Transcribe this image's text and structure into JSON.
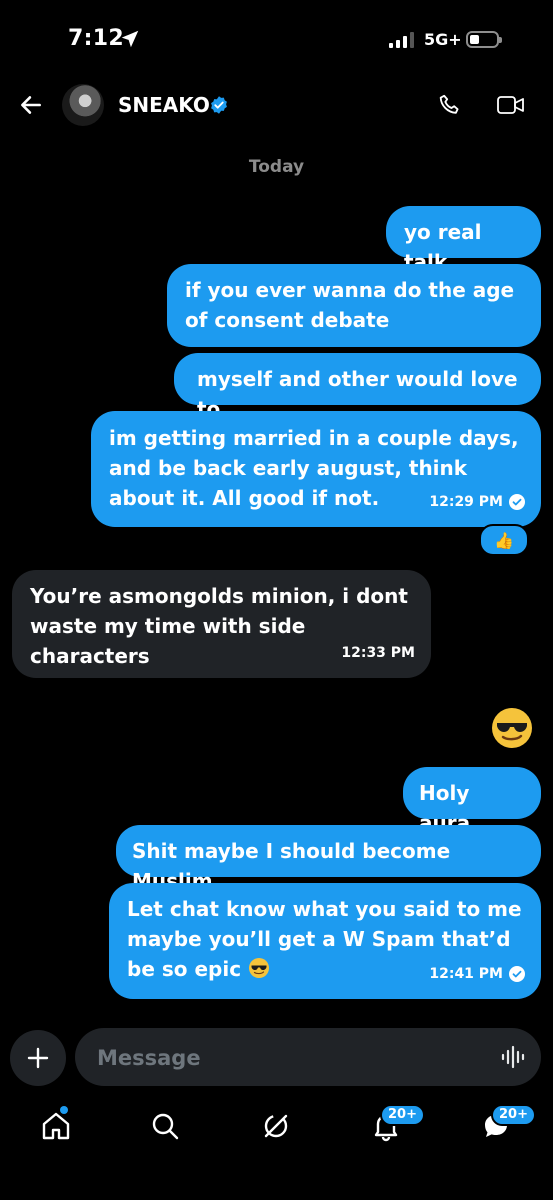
{
  "status_bar": {
    "time": "7:12",
    "network": "5G+"
  },
  "header": {
    "contact_name": "SNEAKO"
  },
  "date_separator": "Today",
  "messages": [
    {
      "text": "yo real talk"
    },
    {
      "text": "if you ever wanna do the age of consent debate"
    },
    {
      "text": "myself and other would love to"
    },
    {
      "text": "im getting married in a couple days, and be back early august, think about it. All good if not.",
      "time": "12:29 PM",
      "reaction": "👍"
    },
    {
      "text": "You’re asmongolds minion, i dont waste my time with side characters",
      "time": "12:33 PM"
    },
    {
      "text": "Holy aura"
    },
    {
      "text": "Shit maybe I should become Muslim"
    },
    {
      "text": "Let chat know what you said to me maybe you’ll get a W Spam that’d be so epic",
      "time": "12:41 PM"
    }
  ],
  "composer": {
    "placeholder": "Message"
  },
  "nav": {
    "notifications_badge": "20+",
    "messages_badge": "20+"
  },
  "colors": {
    "accent": "#1d9bf0",
    "incoming_bubble": "#202327",
    "background": "#000000"
  }
}
